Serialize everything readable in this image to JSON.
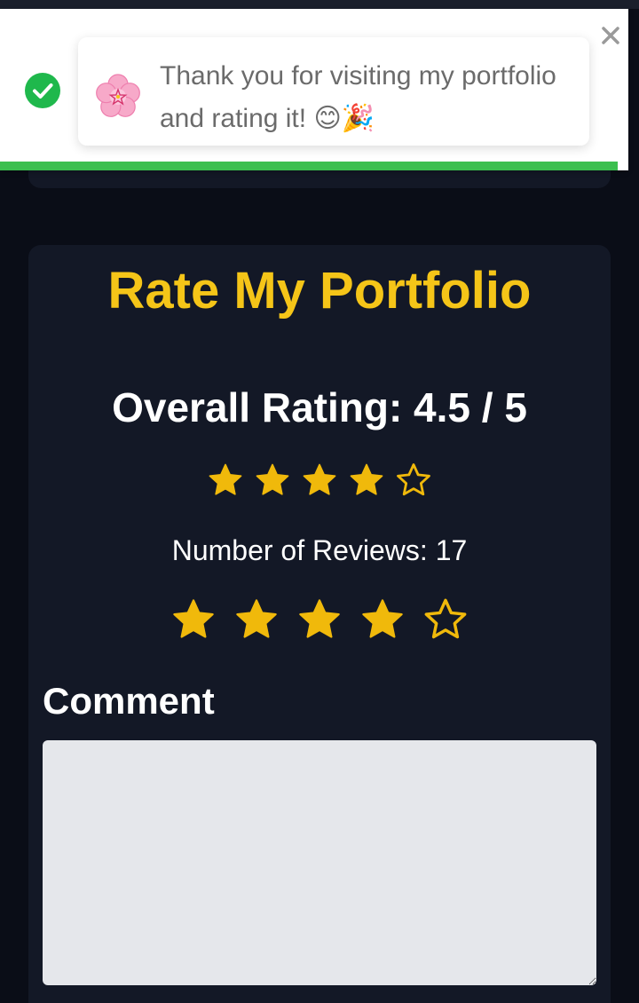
{
  "toast": {
    "message": "Thank you for visiting my portfolio and rating it! 😊🎉",
    "success_icon": "check-circle-icon",
    "flower_icon": "cherry-blossom-icon",
    "close_icon": "close-icon",
    "progress_fraction": 0.983,
    "colors": {
      "success": "#1fb84c",
      "progress": "#3cbf4f",
      "text": "#6b6b6b"
    }
  },
  "rating": {
    "title": "Rate My Portfolio",
    "overall_text": "Overall Rating: 4.5 / 5",
    "overall_value": 4.5,
    "max": 5,
    "display_stars_filled": 4,
    "reviews_text": "Number of Reviews: 17",
    "input_stars_filled": 4,
    "comment_label": "Comment",
    "comment_value": "",
    "colors": {
      "title": "#f5c518",
      "star": "#f0b90b",
      "card": "#131826",
      "background": "#0a0d17"
    }
  }
}
